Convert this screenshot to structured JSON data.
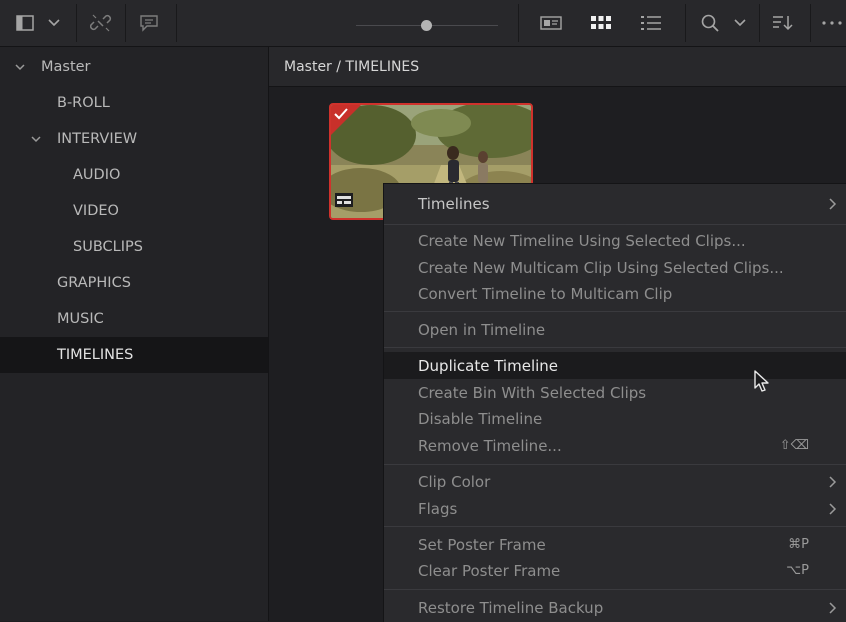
{
  "toolbar": {
    "icons": [
      "sidebar-toggle-icon",
      "chevron-down-icon",
      "unlink-icon",
      "metadata-icon",
      "thumbnail-zoom-slider",
      "metadata-view-icon",
      "thumbnail-view-icon",
      "list-view-icon",
      "search-icon",
      "chevron-down-icon",
      "sort-icon",
      "more-options-icon"
    ]
  },
  "sidebar": {
    "items": [
      {
        "label": "Master",
        "expanded": true
      },
      {
        "label": "B-ROLL"
      },
      {
        "label": "INTERVIEW",
        "expanded": true
      },
      {
        "label": "AUDIO"
      },
      {
        "label": "VIDEO"
      },
      {
        "label": "SUBCLIPS"
      },
      {
        "label": "GRAPHICS"
      },
      {
        "label": "MUSIC"
      },
      {
        "label": "TIMELINES",
        "selected": true
      }
    ]
  },
  "path": "Master / TIMELINES",
  "menu": {
    "items": [
      {
        "label": "Timelines"
      },
      {
        "label": "Create New Timeline Using Selected Clips..."
      },
      {
        "label": "Create New Multicam Clip Using Selected Clips..."
      },
      {
        "label": "Convert Timeline to Multicam Clip"
      },
      {
        "label": "Open in Timeline"
      },
      {
        "label": "Duplicate Timeline"
      },
      {
        "label": "Create Bin With Selected Clips"
      },
      {
        "label": "Disable Timeline"
      },
      {
        "label": "Remove Timeline...",
        "shortcut": "⇧⌫"
      },
      {
        "label": "Clip Color"
      },
      {
        "label": "Flags"
      },
      {
        "label": "Set Poster Frame",
        "shortcut": "⌘P"
      },
      {
        "label": "Clear Poster Frame",
        "shortcut": "⌥P"
      },
      {
        "label": "Restore Timeline Backup"
      }
    ]
  },
  "colors": {
    "selection_border": "#d0322c",
    "menu_bg": "#2a2a2d",
    "sidebar_bg": "#232326"
  }
}
